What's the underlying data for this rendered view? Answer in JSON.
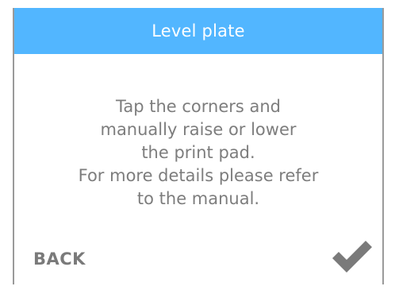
{
  "colors": {
    "accent": "#52b6ff",
    "text": "#7d7d7d",
    "muted": "#7a7a7a"
  },
  "header": {
    "title": "Level plate"
  },
  "message": {
    "lines": [
      "Tap the corners and",
      "manually raise or lower",
      "the print pad.",
      "For more details please refer",
      "to the manual."
    ]
  },
  "footer": {
    "back_label": "BACK",
    "confirm_icon": "checkmark-icon"
  }
}
